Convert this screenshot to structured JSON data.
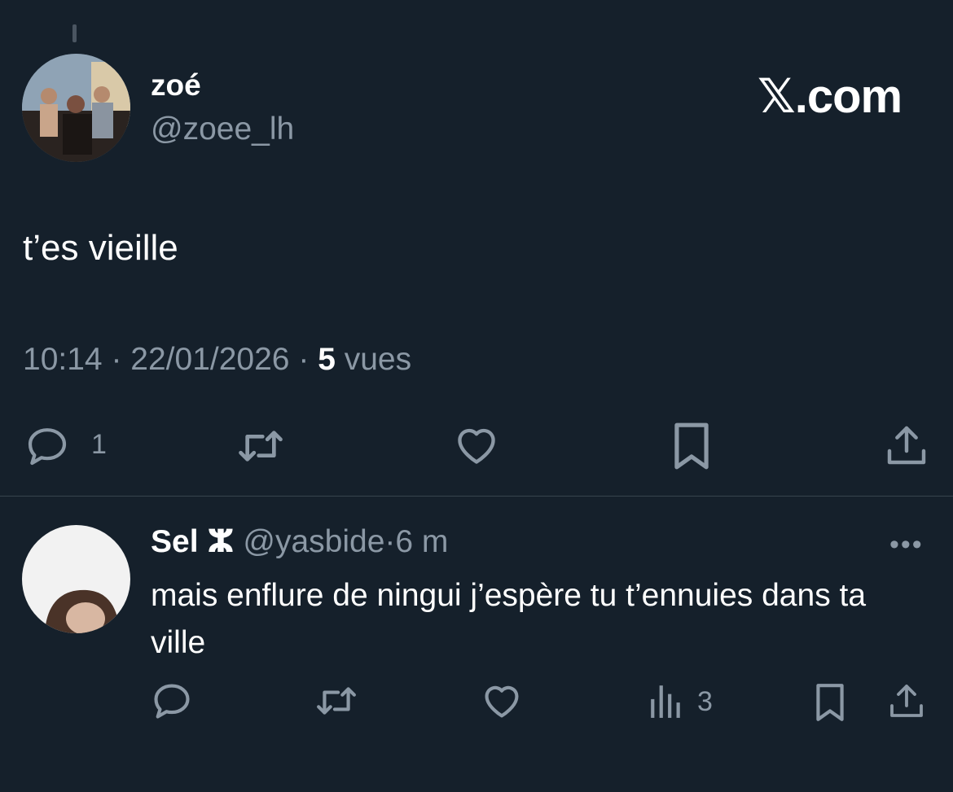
{
  "brand": {
    "label": "𝕏.com"
  },
  "tweet": {
    "author_name": "zoé",
    "author_handle": "@zoee_lh",
    "text": "t’es vieille",
    "time": "10:14",
    "date": "22/01/2026",
    "separator": "·",
    "views_count": "5",
    "views_label": "vues",
    "actions": {
      "reply_count": "1",
      "icons": [
        "reply-icon",
        "retweet-icon",
        "like-icon",
        "bookmark-icon",
        "share-icon"
      ]
    }
  },
  "reply": {
    "author_name": "Sel",
    "author_symbol": "ⵣ",
    "author_handle": "@yasbide",
    "separator": "·",
    "time": "6 m",
    "text": "mais enflure de ningui j’espère tu t’ennuies dans ta ville",
    "more_label": "•••",
    "actions": {
      "views_count": "3",
      "icons": [
        "reply-icon",
        "retweet-icon",
        "like-icon",
        "views-icon",
        "bookmark-icon",
        "share-icon"
      ]
    }
  },
  "colors": {
    "background": "#15202b",
    "text_primary": "#ffffff",
    "text_secondary": "#8b98a5",
    "divider": "#38444d"
  }
}
